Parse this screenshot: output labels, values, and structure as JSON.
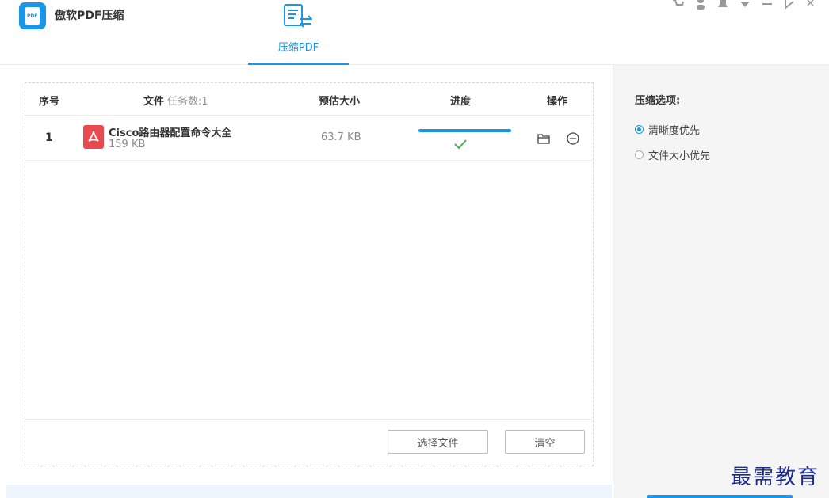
{
  "app": {
    "title": "傲软PDF压缩",
    "logo_text": "PDF"
  },
  "tabs": [
    {
      "label": "压缩PDF",
      "active": true
    }
  ],
  "window_controls": [
    "cart-icon",
    "user-icon",
    "bell-icon",
    "dropdown-icon",
    "minimize-icon",
    "restore-icon",
    "close-icon"
  ],
  "table": {
    "columns": {
      "index": "序号",
      "file": "文件",
      "task_count": "任务数:1",
      "estimated_size": "预估大小",
      "progress": "进度",
      "actions": "操作"
    },
    "rows": [
      {
        "index": "1",
        "name": "Cisco路由器配置命令大全",
        "size": "159 KB",
        "estimated": "63.7 KB",
        "progress": 1.0,
        "status": "done"
      }
    ]
  },
  "footer": {
    "select_label": "选择文件",
    "clear_label": "清空"
  },
  "sidebar": {
    "title": "压缩选项:",
    "options": [
      {
        "label": "清晰度优先",
        "selected": true
      },
      {
        "label": "文件大小优先",
        "selected": false
      }
    ]
  },
  "watermark": "最需教育",
  "colors": {
    "accent": "#1b95e6",
    "pdf_red": "#e94a4f",
    "success": "#4caf50",
    "watermark": "#1c2b8a"
  }
}
